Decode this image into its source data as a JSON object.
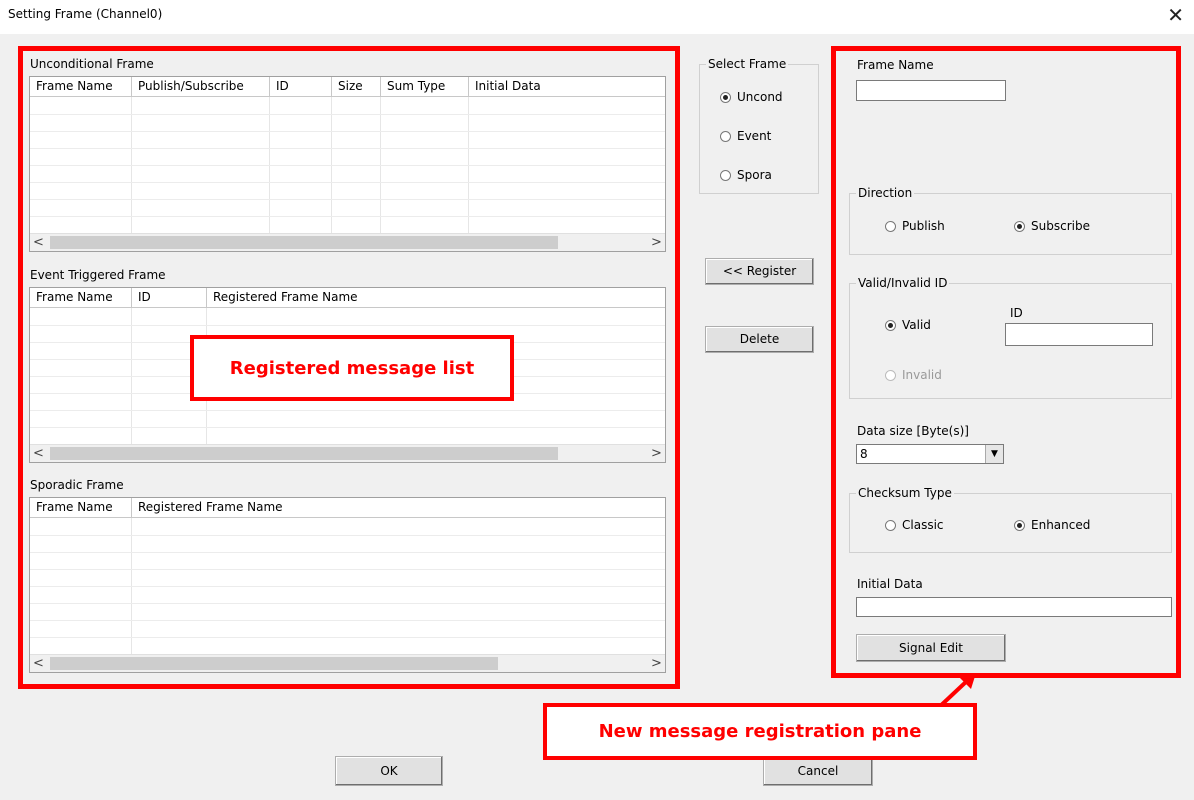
{
  "window": {
    "title": "Setting Frame (Channel0)",
    "close_glyph": "✕"
  },
  "unconditional": {
    "label": "Unconditional Frame",
    "columns": [
      "Frame Name",
      "Publish/Subscribe",
      "ID",
      "Size",
      "Sum Type",
      "Initial Data"
    ]
  },
  "event": {
    "label": "Event Triggered Frame",
    "columns": [
      "Frame Name",
      "ID",
      "Registered Frame Name"
    ]
  },
  "sporadic": {
    "label": "Sporadic Frame",
    "columns": [
      "Frame Name",
      "Registered Frame Name"
    ]
  },
  "scroll": {
    "left": "<",
    "right": ">"
  },
  "select_frame": {
    "label": "Select Frame",
    "options": [
      "Uncond",
      "Event",
      "Spora"
    ],
    "selected": "Uncond"
  },
  "buttons": {
    "register": "<< Register",
    "delete": "Delete",
    "signal_edit": "Signal Edit",
    "ok": "OK",
    "cancel": "Cancel"
  },
  "frame_name": {
    "label": "Frame Name",
    "value": ""
  },
  "direction": {
    "label": "Direction",
    "publish": "Publish",
    "subscribe": "Subscribe",
    "selected": "Subscribe"
  },
  "valid_id": {
    "label": "Valid/Invalid ID",
    "valid": "Valid",
    "invalid": "Invalid",
    "id_label": "ID",
    "id_value": "",
    "selected": "Valid"
  },
  "data_size": {
    "label": "Data size [Byte(s)]",
    "value": "8"
  },
  "checksum": {
    "label": "Checksum Type",
    "classic": "Classic",
    "enhanced": "Enhanced",
    "selected": "Enhanced"
  },
  "initial_data": {
    "label": "Initial Data",
    "value": ""
  },
  "callouts": {
    "list": "Registered message list",
    "pane": "New message registration pane"
  },
  "colors": {
    "highlight": "#ff0000",
    "window_bg": "#f0f0f0"
  }
}
